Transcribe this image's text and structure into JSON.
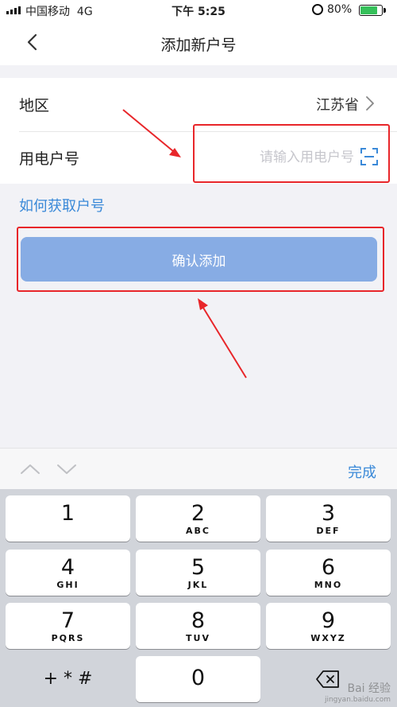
{
  "status_bar": {
    "carrier": "中国移动",
    "network": "4G",
    "time": "下午 5:25",
    "battery": "80%",
    "battery_level": 0.8
  },
  "nav": {
    "title": "添加新户号"
  },
  "form": {
    "region_label": "地区",
    "region_value": "江苏省",
    "account_label": "用电户号",
    "account_placeholder": "请输入用电户号",
    "account_value": ""
  },
  "how_link": "如何获取户号",
  "confirm_button": "确认添加",
  "keyboard_toolbar": {
    "done": "完成"
  },
  "keypad": [
    {
      "digit": "1",
      "letters": ""
    },
    {
      "digit": "2",
      "letters": "ABC"
    },
    {
      "digit": "3",
      "letters": "DEF"
    },
    {
      "digit": "4",
      "letters": "GHI"
    },
    {
      "digit": "5",
      "letters": "JKL"
    },
    {
      "digit": "6",
      "letters": "MNO"
    },
    {
      "digit": "7",
      "letters": "PQRS"
    },
    {
      "digit": "8",
      "letters": "TUV"
    },
    {
      "digit": "9",
      "letters": "WXYZ"
    },
    {
      "digit": "0",
      "letters": ""
    }
  ],
  "symbols_key": "+ * #",
  "watermark": {
    "text": "Bai 经验",
    "sub": "jingyan.baidu.com"
  },
  "colors": {
    "accent": "#3a89d8",
    "button": "#87ace4",
    "highlight": "#e8262a",
    "keyboard_bg": "#d1d4da"
  }
}
